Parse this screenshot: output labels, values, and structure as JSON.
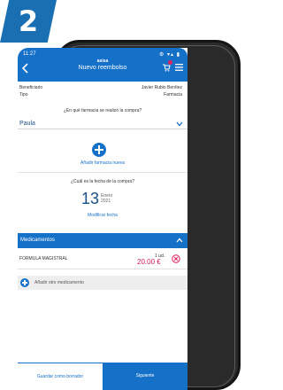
{
  "step": {
    "number": "2"
  },
  "status_bar": {
    "time": "11:27",
    "icons": "⚙ ▾▴ ▮"
  },
  "header": {
    "brand": "asisa",
    "title": "Nuevo reembolso"
  },
  "info": {
    "beneficiary_label": "Beneficiario",
    "beneficiary_value": "Javier Rubio Benítez",
    "type_label": "Tipo",
    "type_value": "Farmacia"
  },
  "pharmacy": {
    "question": "¿En qué farmacia se realizó la compra?",
    "selected": "Paula",
    "add_label": "Añadir farmacia nueva"
  },
  "purchase_date": {
    "question": "¿Cuál es la fecha de la compra?",
    "day": "13",
    "month": "Enero",
    "year": "2021",
    "modify_label": "Modificar fecha"
  },
  "medicines": {
    "title": "Medicamentos",
    "items": [
      {
        "name": "FORMULA MAGISTRAL",
        "qty": "1 ud.",
        "price": "20.00 €"
      }
    ],
    "add_label": "Añadir otro medicamento"
  },
  "actions": {
    "draft_label": "Guardar como borrador",
    "next_label": "Siguiente"
  },
  "colors": {
    "primary": "#1570c8",
    "badge": "#1a6fb3",
    "price": "#d81c5c"
  }
}
